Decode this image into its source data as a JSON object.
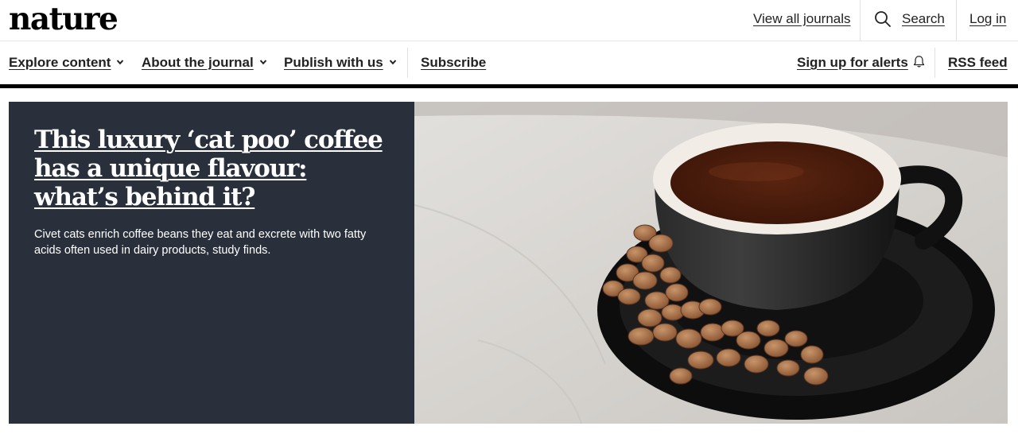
{
  "header": {
    "logo": "nature",
    "links": {
      "view_all_journals": "View all journals",
      "search": "Search",
      "login": "Log in"
    },
    "icons": {
      "search": "search-icon"
    }
  },
  "nav": {
    "items": [
      {
        "label": "Explore content",
        "icon": "chevron-down-icon"
      },
      {
        "label": "About the journal",
        "icon": "chevron-down-icon"
      },
      {
        "label": "Publish with us",
        "icon": "chevron-down-icon"
      },
      {
        "label": "Subscribe"
      }
    ],
    "alerts": {
      "label": "Sign up for alerts",
      "icon": "bell-icon"
    },
    "rss": {
      "label": "RSS feed"
    }
  },
  "hero": {
    "title": "This luxury ‘cat poo’ coffee has a unique flavour: what’s behind it?",
    "standfirst": "Civet cats enrich coffee beans they eat and excrete with two fatty acids often used in dairy products, study finds.",
    "image_alt": "coffee-cup-with-civet-coffee-beans",
    "colors": {
      "panel": "#29303b",
      "text": "#ffffff"
    }
  }
}
